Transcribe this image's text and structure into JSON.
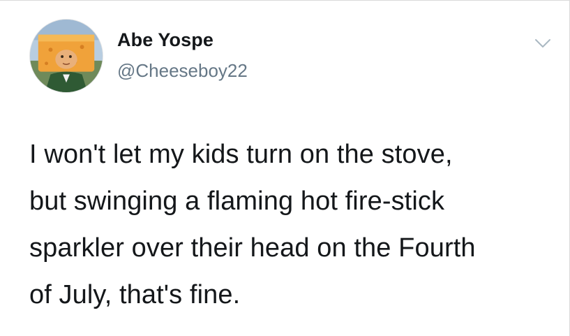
{
  "tweet": {
    "author": {
      "display_name": "Abe Yospe",
      "handle": "@Cheeseboy22",
      "avatar_icon": "cheese-character-avatar"
    },
    "menu_icon": "chevron-down-icon",
    "text": "I won't let my kids turn on the stove,\nbut swinging a flaming hot fire-stick\nsparkler over their head on the Fourth\nof July, that's fine."
  },
  "colors": {
    "background": "#ffffff",
    "name_text": "#14171a",
    "handle_text": "#657786",
    "body_text": "#14171a",
    "chevron": "#aab8c2"
  }
}
